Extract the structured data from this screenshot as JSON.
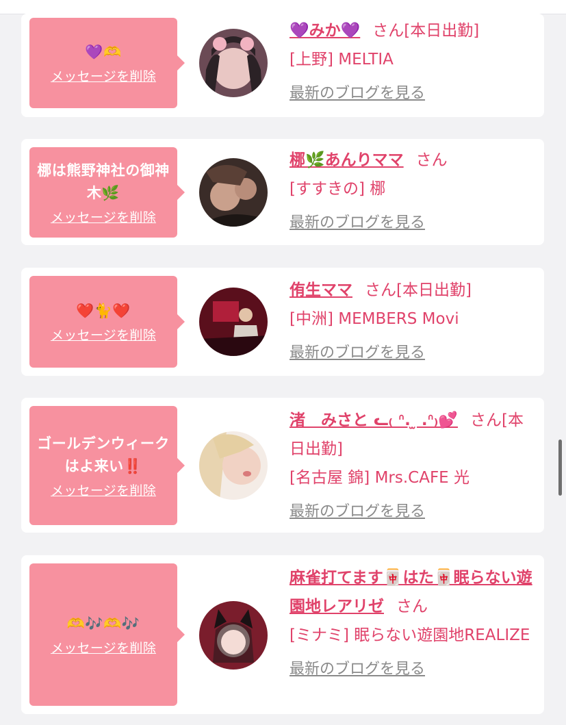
{
  "delete_label": "メッセージを削除",
  "blog_label": "最新のブログを見る",
  "san_label": "さん",
  "cards": [
    {
      "bubble": "💜🫶",
      "name": "💜みか💜",
      "status": "[本日出勤]",
      "shop": "[上野] MELTIA"
    },
    {
      "bubble": "梛は熊野神社の御神木🌿",
      "name": "梛🌿あんりママ",
      "status": "",
      "shop": "[すすきの] 梛"
    },
    {
      "bubble": "❤️🐈❤️",
      "name": "侑生ママ",
      "status": "[本日出勤]",
      "shop": "[中洲] MEMBERS Movi"
    },
    {
      "bubble": "ゴールデンウィークはよ来い‼️",
      "name": "渚　みさと ᓚ₍ ᐢ. ̫ .ᐢ₎💕",
      "status": "[本日出勤]",
      "shop": "[名古屋 錦] Mrs.CAFE 光"
    },
    {
      "bubble": "🫶🎶🫶🎶",
      "name": "麻雀打てます🀄はた🀄眠らない遊園地レアリゼ",
      "status": "",
      "shop": "[ミナミ] 眠らない遊園地REALIZE"
    }
  ]
}
